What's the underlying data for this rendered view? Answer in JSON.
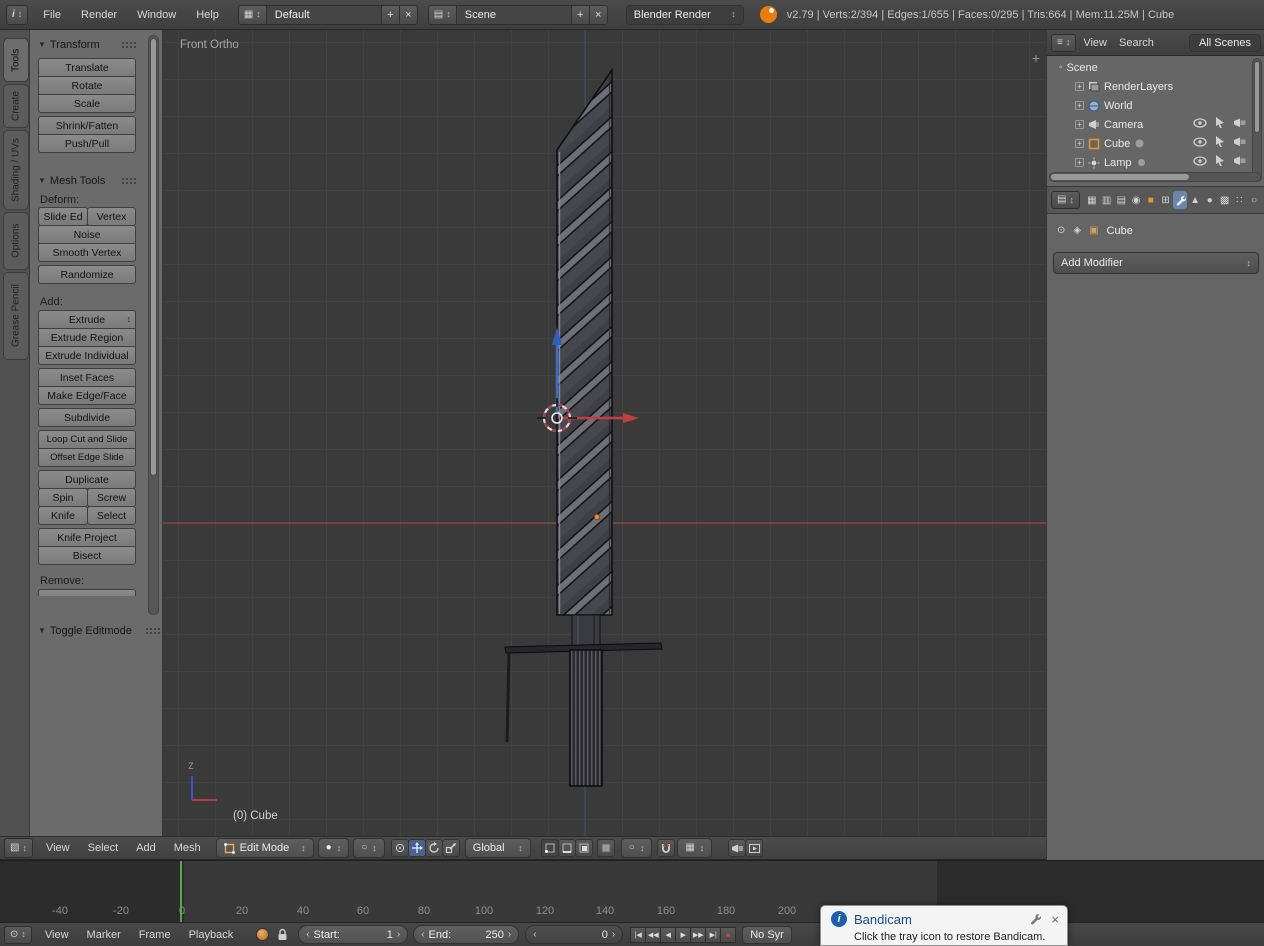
{
  "colors": {
    "accent": "#5680c2",
    "object_orange": "#e8913a",
    "frame_green": "#57a64a",
    "axis_red": "#b04040",
    "axis_blue": "#3a6cc8",
    "bandicam_blue": "#1c4a8c"
  },
  "icons": {
    "updown": "↕",
    "collapse": "▼",
    "plus": "+",
    "close": "×",
    "info": "i",
    "grid": "▦",
    "tree": "≡",
    "props": "▤",
    "clock": "⊙",
    "sphere": "●",
    "circle": "○",
    "expand": "+",
    "dot": "·"
  },
  "top_header": {
    "menus": [
      "File",
      "Render",
      "Window",
      "Help"
    ],
    "layout_field": "Default",
    "scene_field": "Scene",
    "engine_dropdown": "Blender Render",
    "stats": "v2.79 | Verts:2/394 | Edges:1/655 | Faces:0/295 | Tris:664 | Mem:11.25M | Cube"
  },
  "tool_shelf": {
    "tabs": [
      "Tools",
      "Create",
      "Shading / UVs",
      "Options",
      "Grease Pencil"
    ],
    "transform": {
      "title": "Transform",
      "buttons": [
        "Translate",
        "Rotate",
        "Scale",
        "Shrink/Fatten",
        "Push/Pull"
      ]
    },
    "mesh_tools": {
      "title": "Mesh Tools",
      "deform_label": "Deform:",
      "slide": "Slide Ed",
      "vertex": "Vertex",
      "buttons1": [
        "Noise",
        "Smooth Vertex",
        "Randomize"
      ],
      "add_label": "Add:",
      "extrude": "Extrude",
      "buttons2": [
        "Extrude Region",
        "Extrude Individual",
        "Inset Faces",
        "Make Edge/Face",
        "Subdivide",
        "Loop Cut and Slide",
        "Offset Edge Slide",
        "Duplicate"
      ],
      "spin": "Spin",
      "screw": "Screw",
      "knife": "Knife",
      "select": "Select",
      "buttons3": [
        "Knife Project",
        "Bisect"
      ],
      "remove_label": "Remove:"
    },
    "toggle_panel": "Toggle Editmode"
  },
  "viewport": {
    "view_label": "Front Ortho",
    "object_label": "(0) Cube",
    "axis_z": "z"
  },
  "outliner": {
    "header_menus": [
      "View",
      "Search"
    ],
    "scope": "All Scenes",
    "rows": [
      {
        "label": "Scene"
      },
      {
        "label": "RenderLayers"
      },
      {
        "label": "World"
      },
      {
        "label": "Camera"
      },
      {
        "label": "Cube"
      },
      {
        "label": "Lamp"
      }
    ]
  },
  "properties": {
    "breadcrumb": "Cube",
    "add_modifier": "Add Modifier"
  },
  "view3d_header": {
    "menus": [
      "View",
      "Select",
      "Add",
      "Mesh"
    ],
    "mode": "Edit Mode",
    "orientation": "Global"
  },
  "timeline": {
    "menus": [
      "View",
      "Marker",
      "Frame",
      "Playback"
    ],
    "start_label": "Start:",
    "start_value": "1",
    "end_label": "End:",
    "end_value": "250",
    "frame_value": "0",
    "sync": "No Syr",
    "transport": [
      "|◀",
      "◀◀",
      "◀",
      "▶",
      "▶▶",
      "▶|"
    ],
    "record": "●",
    "ticks": [
      "-40",
      "-20",
      "0",
      "20",
      "40",
      "60",
      "80",
      "100",
      "120",
      "140",
      "160",
      "180",
      "200"
    ]
  },
  "bandicam": {
    "title": "Bandicam",
    "message": "Click the tray icon to restore Bandicam."
  }
}
